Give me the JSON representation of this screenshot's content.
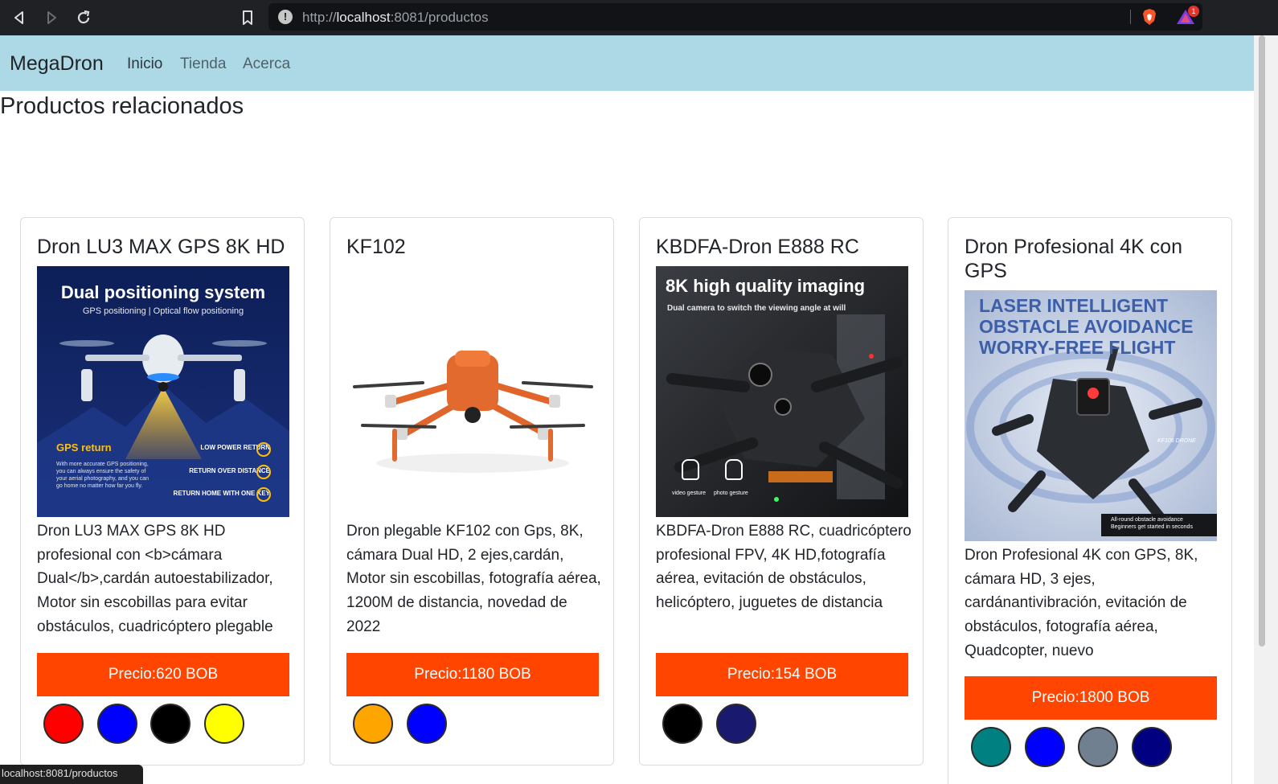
{
  "browser": {
    "url_scheme": "http://",
    "url_host": "localhost",
    "url_rest": ":8081/productos",
    "rewards_badge": "1"
  },
  "navbar": {
    "brand": "MegaDron",
    "links": [
      {
        "label": "Inicio"
      },
      {
        "label": "Tienda"
      },
      {
        "label": "Acerca"
      }
    ],
    "background": "#add8e6"
  },
  "page": {
    "title": "Productos relacionados"
  },
  "products": [
    {
      "title": "Dron LU3 MAX GPS 8K HD",
      "image": {
        "headline": "Dual positioning system",
        "subline": "GPS positioning  |  Optical flow positioning",
        "gps_return": "GPS return",
        "gps_note": "With more accurate GPS positioning, you can always ensure the safety of your aerial photography, and you can go home no matter how far you fly.",
        "features": [
          "LOW POWER RETURN",
          "RETURN OVER DISTANCE",
          "RETURN HOME WITH ONE KEY"
        ]
      },
      "description": "Dron LU3 MAX GPS 8K HD profesional con <b>cámara Dual</b>,cardán autoestabilizador, Motor sin escobillas para evitar obstáculos, cuadricóptero plegable",
      "price": "Precio:620 BOB",
      "colors": [
        "#ff0000",
        "#0000ff",
        "#000000",
        "#ffff00"
      ]
    },
    {
      "title": "KF102",
      "image": {},
      "description": "Dron plegable KF102 con Gps, 8K, cámara Dual HD, 2 ejes,cardán, Motor sin escobillas, fotografía aérea, 1200M de distancia, novedad de 2022",
      "price": "Precio:1180 BOB",
      "colors": [
        "#ffa500",
        "#0000ff"
      ]
    },
    {
      "title": "KBDFA-Dron E888 RC",
      "image": {
        "headline": "8K high quality imaging",
        "subline": "Dual camera to switch the viewing angle at will",
        "gesture_1": "video gesture",
        "gesture_2": "photo gesture"
      },
      "description": "KBDFA-Dron E888 RC, cuadricóptero profesional FPV, 4K HD,fotografía aérea, evitación de obstáculos, helicóptero, juguetes de distancia",
      "price": "Precio:154 BOB",
      "colors": [
        "#000000",
        "#191970"
      ]
    },
    {
      "title": "Dron Profesional 4K con GPS",
      "image": {
        "headline_1": "LASER INTELLIGENT",
        "headline_2": "OBSTACLE AVOIDANCE",
        "headline_3": "WORRY-FREE FLIGHT",
        "model": "KF105 DRONE",
        "footer_1": "All-round obstacle avoidance",
        "footer_2": "Beginners get started in seconds"
      },
      "description": "Dron Profesional 4K con GPS, 8K, cámara HD, 3 ejes, cardánantivibración, evitación de obstáculos, fotografía aérea, Quadcopter, nuevo",
      "price": "Precio:1800 BOB",
      "colors": [
        "#008080",
        "#0000ff",
        "#708090",
        "#000080"
      ]
    }
  ],
  "status_bar": {
    "text": "localhost:8081/productos"
  },
  "theme": {
    "price_button": "#ff4500",
    "text": "#212529"
  }
}
